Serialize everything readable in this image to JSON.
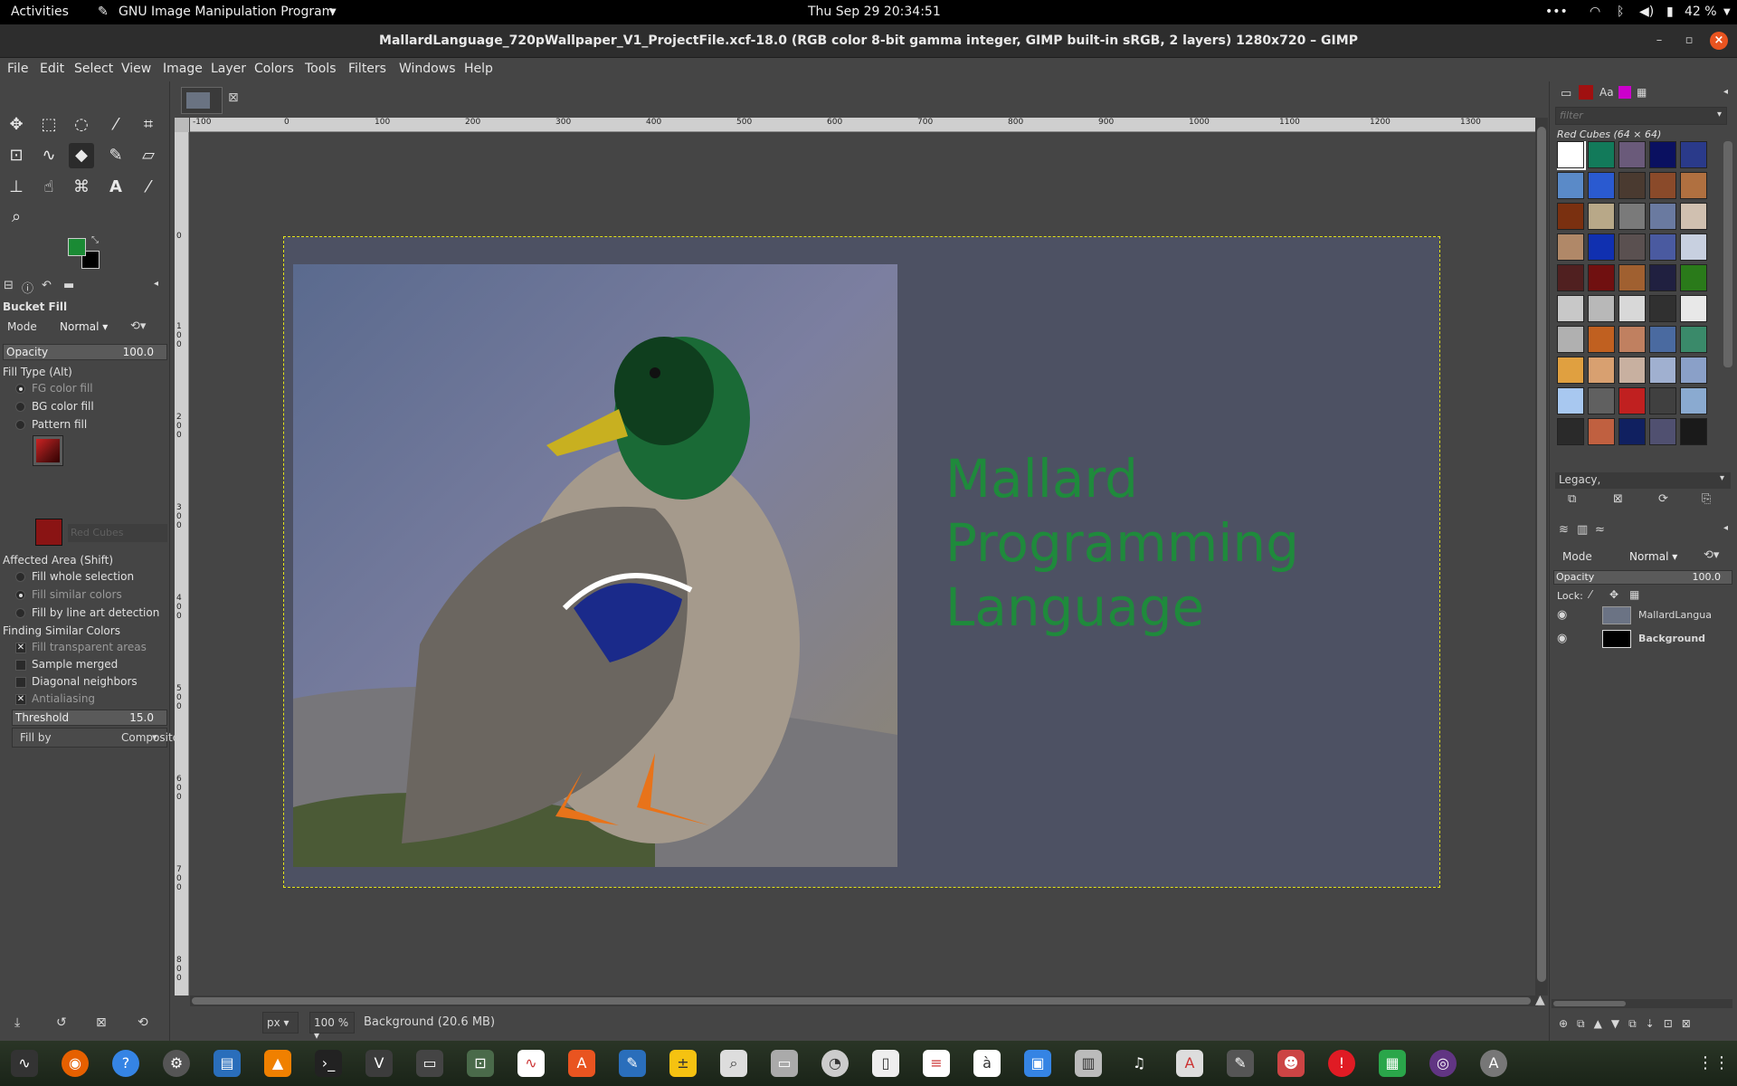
{
  "topbar": {
    "activities": "Activities",
    "app_name": "GNU Image Manipulation Program",
    "clock": "Thu Sep 29  20:34:51",
    "more": "•••",
    "battery": "42 %"
  },
  "window": {
    "title": "MallardLanguage_720pWallpaper_V1_ProjectFile.xcf-18.0 (RGB color 8-bit gamma integer, GIMP built-in sRGB, 2 layers) 1280x720 – GIMP"
  },
  "menu": [
    "File",
    "Edit",
    "Select",
    "View",
    "Image",
    "Layer",
    "Colors",
    "Tools",
    "Filters",
    "Windows",
    "Help"
  ],
  "colors": {
    "fg": "#1a8a34",
    "bg": "#000000",
    "accent": "#e95420",
    "slogan": "#1f8a3c",
    "selection": "#e3e31a"
  },
  "tool_options": {
    "title": "Bucket Fill",
    "mode_label": "Mode",
    "mode_value": "Normal",
    "opacity_label": "Opacity",
    "opacity_value": "100.0",
    "fill_type_label": "Fill Type  (Alt)",
    "fill_types": [
      "FG color fill",
      "BG color fill",
      "Pattern fill"
    ],
    "fill_type_selected": 0,
    "pattern_name": "Red Cubes",
    "affected_label": "Affected Area  (Shift)",
    "affected": [
      "Fill whole selection",
      "Fill similar colors",
      "Fill by line art detection"
    ],
    "affected_selected": 1,
    "similar_label": "Finding Similar Colors",
    "similar_options": [
      {
        "label": "Fill transparent areas",
        "checked": true
      },
      {
        "label": "Sample merged",
        "checked": false
      },
      {
        "label": "Diagonal neighbors",
        "checked": false
      },
      {
        "label": "Antialiasing",
        "checked": true
      }
    ],
    "threshold_label": "Threshold",
    "threshold_value": "15.0",
    "fillby_label": "Fill by",
    "fillby_value": "Composite"
  },
  "canvas": {
    "slogan_lines": [
      "Mallard",
      "Programming",
      "Language"
    ],
    "ruler_h": [
      "-100",
      "0",
      "100",
      "200",
      "300",
      "400",
      "500",
      "600",
      "700",
      "800",
      "900",
      "1000",
      "1100",
      "1200",
      "1300"
    ],
    "ruler_v": [
      "0",
      "1 0 0",
      "2 0 0",
      "3 0 0",
      "4 0 0",
      "5 0 0",
      "6 0 0",
      "7 0 0",
      "8 0 0"
    ]
  },
  "status": {
    "unit": "px",
    "zoom": "100 %",
    "info": "Background (20.6 MB)"
  },
  "patterns": {
    "filter_placeholder": "filter",
    "current": "Red Cubes (64 × 64)",
    "tag": "Legacy,"
  },
  "layers": {
    "mode_label": "Mode",
    "mode_value": "Normal",
    "opacity_label": "Opacity",
    "opacity_value": "100.0",
    "lock_label": "Lock:",
    "items": [
      {
        "name": "MallardLangua",
        "visible": true
      },
      {
        "name": "Background",
        "visible": true
      }
    ]
  }
}
